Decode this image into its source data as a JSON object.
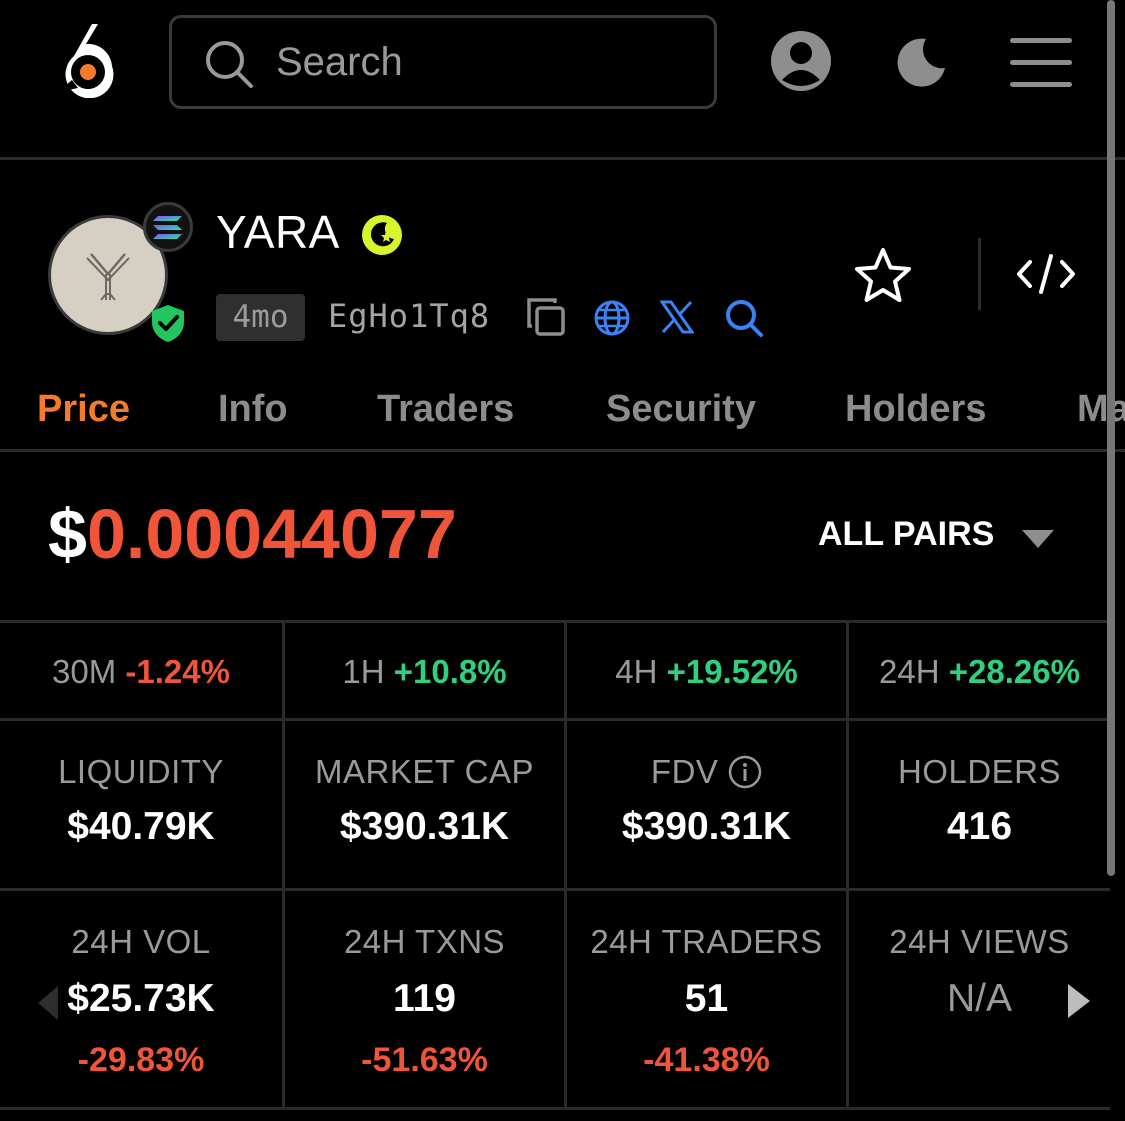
{
  "header": {
    "search_placeholder": "Search"
  },
  "token": {
    "name": "YARA",
    "age": "4mo",
    "address": "EgHo1Tq8"
  },
  "tabs": [
    "Price",
    "Info",
    "Traders",
    "Security",
    "Holders",
    "Ma"
  ],
  "active_tab": "Price",
  "price": {
    "currency": "$",
    "value": "0.00044077",
    "pairs_label": "ALL PAIRS"
  },
  "changes": [
    {
      "label": "30M",
      "value": "-1.24%",
      "direction": "down"
    },
    {
      "label": "1H",
      "value": "+10.8%",
      "direction": "up"
    },
    {
      "label": "4H",
      "value": "+19.52%",
      "direction": "up"
    },
    {
      "label": "24H",
      "value": "+28.26%",
      "direction": "up"
    }
  ],
  "stats": [
    {
      "label": "LIQUIDITY",
      "value": "$40.79K"
    },
    {
      "label": "MARKET CAP",
      "value": "$390.31K"
    },
    {
      "label": "FDV",
      "value": "$390.31K"
    },
    {
      "label": "HOLDERS",
      "value": "416"
    }
  ],
  "stats24h": [
    {
      "label": "24H VOL",
      "value": "$25.73K",
      "change": "-29.83%"
    },
    {
      "label": "24H TXNS",
      "value": "119",
      "change": "-51.63%"
    },
    {
      "label": "24H TRADERS",
      "value": "51",
      "change": "-41.38%"
    },
    {
      "label": "24H VIEWS",
      "value": "N/A",
      "change": ""
    }
  ],
  "colors": {
    "accent": "#f47b2a",
    "positive": "#2fd07f",
    "negative": "#f0553a",
    "link_blue": "#3b82f6"
  }
}
